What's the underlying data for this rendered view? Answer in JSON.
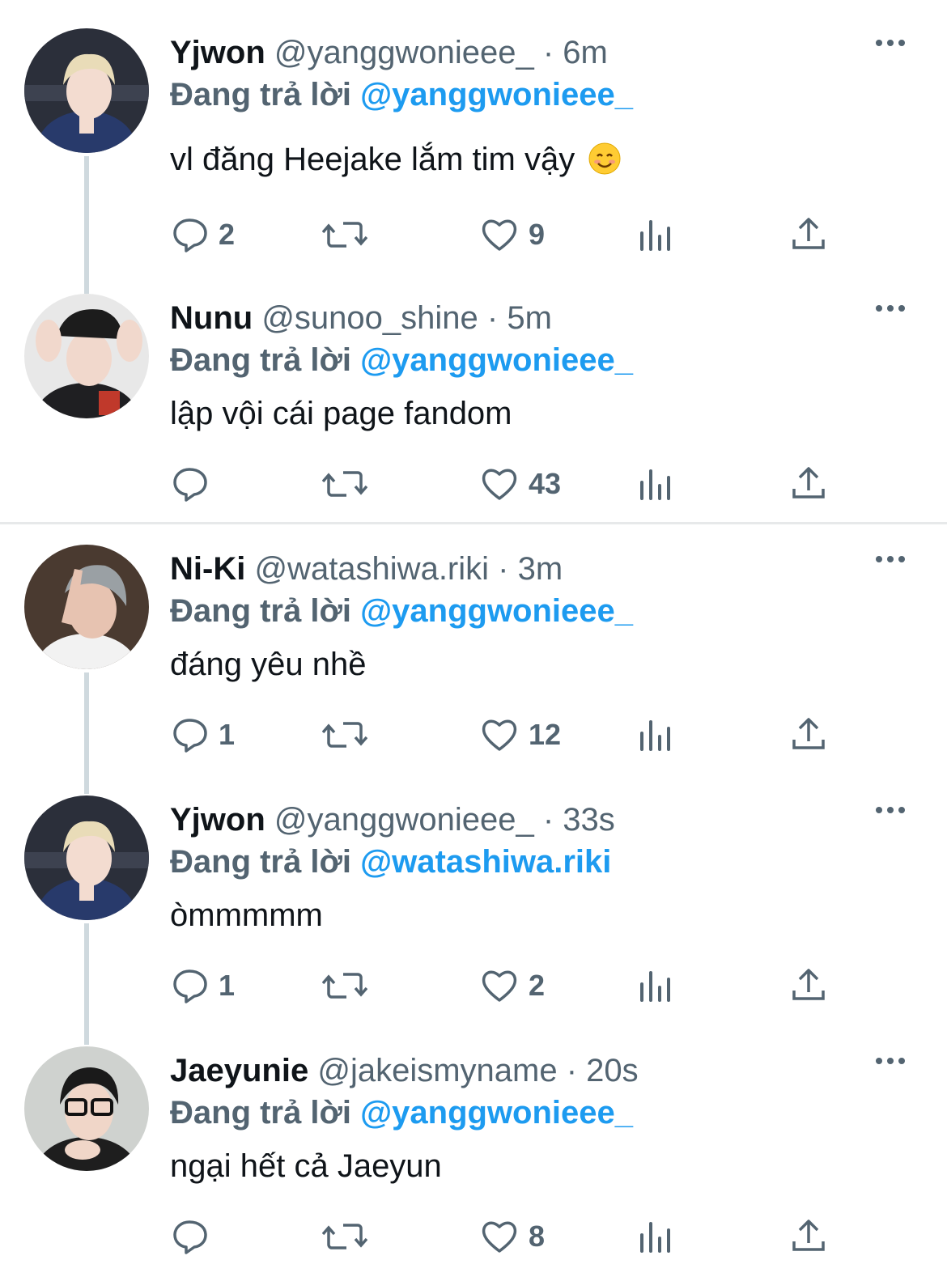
{
  "tweets": [
    {
      "display_name": "Yjwon",
      "handle_time": "@yanggwonieee_ · 6m",
      "replying_prefix": "Đang trả lời ",
      "replying_to": "@yanggwonieee_",
      "text": "vl đăng Heejake lắm tim vậy",
      "emoji": "smiling-face-emoji",
      "replies": "2",
      "retweets": "",
      "likes": "9",
      "avatar": "yjwon-avatar",
      "avatar_colors": {
        "bg": "#2b2f3a",
        "hair": "#e9dcb8",
        "face": "#f3dcd0",
        "shirt": "#283a6b"
      }
    },
    {
      "display_name": "Nunu",
      "handle_time": "@sunoo_shine · 5m",
      "replying_prefix": "Đang trả lời ",
      "replying_to": "@yanggwonieee_",
      "text": "lập vội cái page fandom",
      "replies": "",
      "retweets": "",
      "likes": "43",
      "avatar": "nunu-avatar",
      "avatar_colors": {
        "bg": "#e8e8e8",
        "hair": "#1c1c1c",
        "face": "#f1d8cc",
        "shirt": "#1f1f22"
      }
    },
    {
      "display_name": "Ni-Ki",
      "handle_time": "@watashiwa.riki · 3m",
      "replying_prefix": "Đang trả lời ",
      "replying_to": "@yanggwonieee_",
      "text": "đáng yêu nhề",
      "replies": "1",
      "retweets": "",
      "likes": "12",
      "avatar": "niki-avatar",
      "avatar_colors": {
        "bg": "#4a3a30",
        "hair": "#9aa0a4",
        "face": "#e7c3b1",
        "shirt": "#f2f2f2"
      }
    },
    {
      "display_name": "Yjwon",
      "handle_time": "@yanggwonieee_ · 33s",
      "replying_prefix": "Đang trả lời ",
      "replying_to": "@watashiwa.riki",
      "text": "òmmmmm",
      "replies": "1",
      "retweets": "",
      "likes": "2",
      "avatar": "yjwon-avatar",
      "avatar_colors": {
        "bg": "#2b2f3a",
        "hair": "#e9dcb8",
        "face": "#f3dcd0",
        "shirt": "#283a6b"
      }
    },
    {
      "display_name": "Jaeyunie",
      "handle_time": "@jakeismyname · 20s",
      "replying_prefix": "Đang trả lời ",
      "replying_to": "@yanggwonieee_",
      "text": "ngại hết cả Jaeyun",
      "replies": "",
      "retweets": "",
      "likes": "8",
      "avatar": "jaeyunie-avatar",
      "avatar_colors": {
        "bg": "#cfd2cf",
        "hair": "#1a1a1a",
        "face": "#f0d6c8",
        "shirt": "#1e1e1e"
      }
    }
  ],
  "colors": {
    "accent": "#1d9bf0",
    "secondary_text": "#536471",
    "thread_line": "#cfd9de"
  },
  "icons": [
    "reply-icon",
    "retweet-icon",
    "like-icon",
    "views-icon",
    "share-icon",
    "more-icon"
  ]
}
